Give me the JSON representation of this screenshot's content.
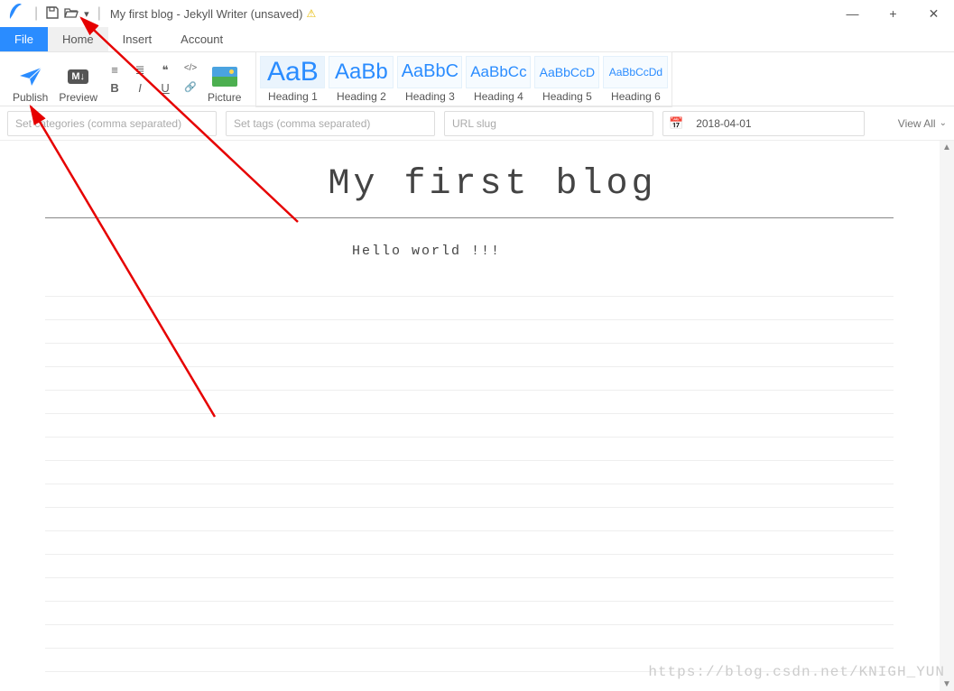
{
  "titlebar": {
    "title": "My first blog - Jekyll Writer (unsaved)",
    "warn_icon": "⚠"
  },
  "menu": {
    "file": "File",
    "home": "Home",
    "insert": "Insert",
    "account": "Account"
  },
  "ribbon": {
    "publish": "Publish",
    "preview": "Preview",
    "preview_badge": "M↓",
    "picture": "Picture",
    "fmt": {
      "ul": "≡",
      "ol": "≣",
      "quote": "❝",
      "code": "</>",
      "bold": "B",
      "italic": "I",
      "underline": "U",
      "link": "🔗"
    },
    "headings": [
      {
        "sample": "AaB",
        "label": "Heading 1",
        "size": "30px"
      },
      {
        "sample": "AaBb",
        "label": "Heading 2",
        "size": "24px"
      },
      {
        "sample": "AaBbC",
        "label": "Heading 3",
        "size": "20px"
      },
      {
        "sample": "AaBbCc",
        "label": "Heading 4",
        "size": "17px"
      },
      {
        "sample": "AaBbCcD",
        "label": "Heading 5",
        "size": "14px"
      },
      {
        "sample": "AaBbCcDd",
        "label": "Heading 6",
        "size": "12px"
      }
    ]
  },
  "meta": {
    "categories_placeholder": "Set categories (comma separated)",
    "tags_placeholder": "Set tags (comma separated)",
    "slug_placeholder": "URL slug",
    "date_value": "2018-04-01",
    "view_all": "View All"
  },
  "editor": {
    "title": "My first blog",
    "body": "Hello world !!!"
  },
  "watermark": "https://blog.csdn.net/KNIGH_YUN"
}
